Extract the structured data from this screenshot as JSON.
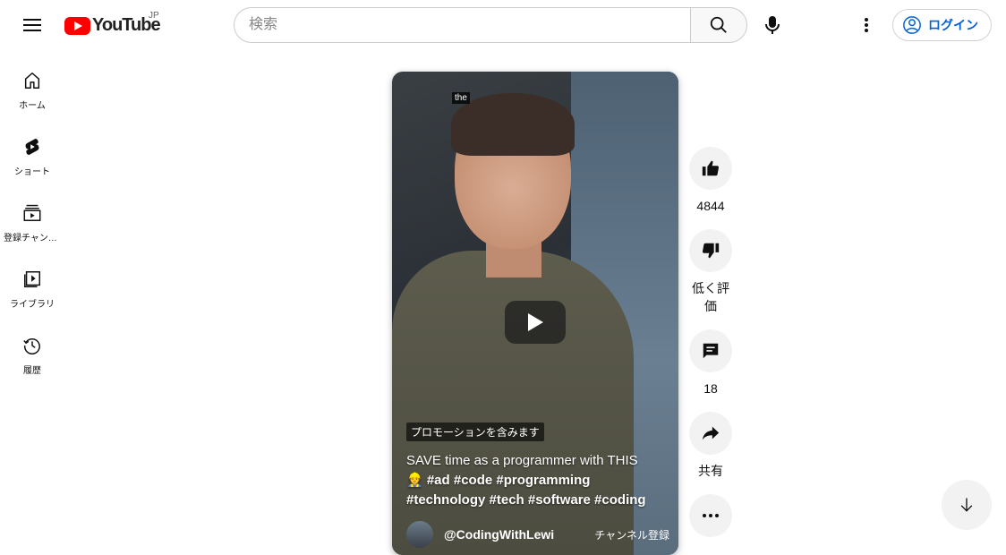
{
  "header": {
    "logo_text": "YouTube",
    "region": "JP",
    "search_placeholder": "検索",
    "login_label": "ログイン"
  },
  "sidebar": {
    "items": [
      {
        "label": "ホーム",
        "icon": "home-icon"
      },
      {
        "label": "ショート",
        "icon": "shorts-icon"
      },
      {
        "label": "登録チャンネル",
        "icon": "subscriptions-icon"
      },
      {
        "label": "ライブラリ",
        "icon": "library-icon"
      },
      {
        "label": "履歴",
        "icon": "history-icon"
      }
    ]
  },
  "video": {
    "caption": "the",
    "promo_label": "プロモーションを含みます",
    "title_text": "SAVE time as a programmer with THIS",
    "title_tags": "👷 #ad #code #programming #technology #tech #software #coding",
    "channel_name": "@CodingWithLewi",
    "subscribe_label": "チャンネル登録"
  },
  "actions": {
    "like_count": "4844",
    "dislike_label": "低く評価",
    "comment_count": "18",
    "share_label": "共有"
  },
  "colors": {
    "brand_red": "#ff0000",
    "link_blue": "#065fd4",
    "button_gray": "#f2f2f2"
  }
}
